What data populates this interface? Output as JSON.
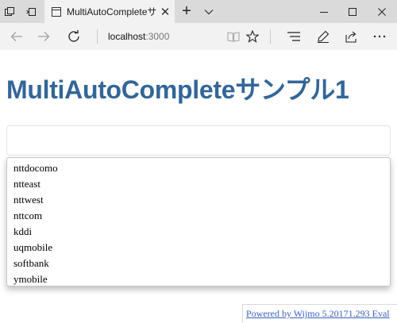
{
  "browser": {
    "tab_title": "MultiAutoCompleteサンプ",
    "tab_close_glyph": "✕",
    "new_tab_glyph": "+",
    "address_host": "localhost",
    "address_port": ":3000"
  },
  "page": {
    "title": "MultiAutoCompleteサンプル1",
    "input_value": "",
    "suggestions": [
      "nttdocomo",
      "ntteast",
      "nttwest",
      "nttcom",
      "kddi",
      "uqmobile",
      "softbank",
      "ymobile"
    ],
    "footer_link": "Powered by Wijmo 5.20171.293 Eval"
  },
  "icons": {
    "tab_favicon": "page-icon",
    "back": "arrow-left-icon",
    "forward": "arrow-right-icon",
    "refresh": "refresh-icon",
    "reading_view": "book-icon",
    "favorite": "star-icon",
    "hub": "hub-icon",
    "notes": "pen-icon",
    "share": "share-icon",
    "more": "more-icon"
  },
  "colors": {
    "title": "#336699",
    "link": "#3b5fc0",
    "tab_active": "#f2f2f2",
    "titlebar": "#dadada"
  }
}
